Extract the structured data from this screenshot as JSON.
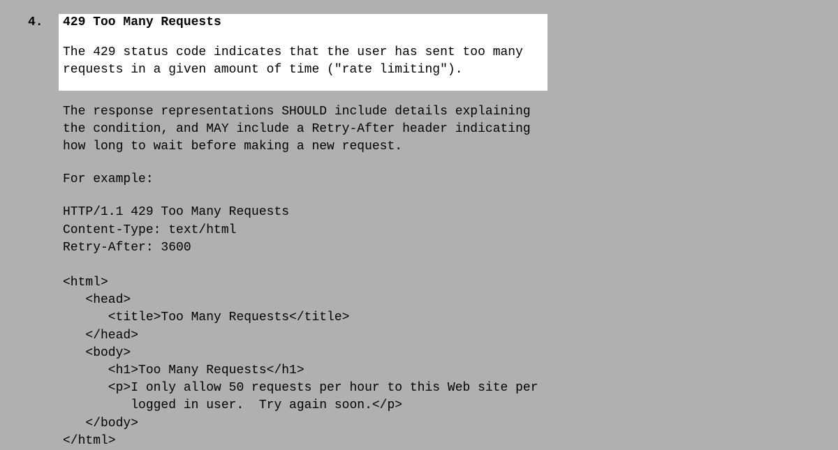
{
  "section": {
    "number": "4.",
    "title": "429 Too Many Requests",
    "intro_para": "The 429 status code indicates that the user has sent too many requests in a given amount of time (\"rate limiting\").",
    "detail_para": "The response representations SHOULD include details explaining the condition, and MAY include a Retry-After header indicating how long to wait before making a new request.",
    "example_label": "For example:",
    "example_code": "HTTP/1.1 429 Too Many Requests\nContent-Type: text/html\nRetry-After: 3600\n\n<html>\n   <head>\n      <title>Too Many Requests</title>\n   </head>\n   <body>\n      <h1>Too Many Requests</h1>\n      <p>I only allow 50 requests per hour to this Web site per\n         logged in user.  Try again soon.</p>\n   </body>\n</html>"
  }
}
